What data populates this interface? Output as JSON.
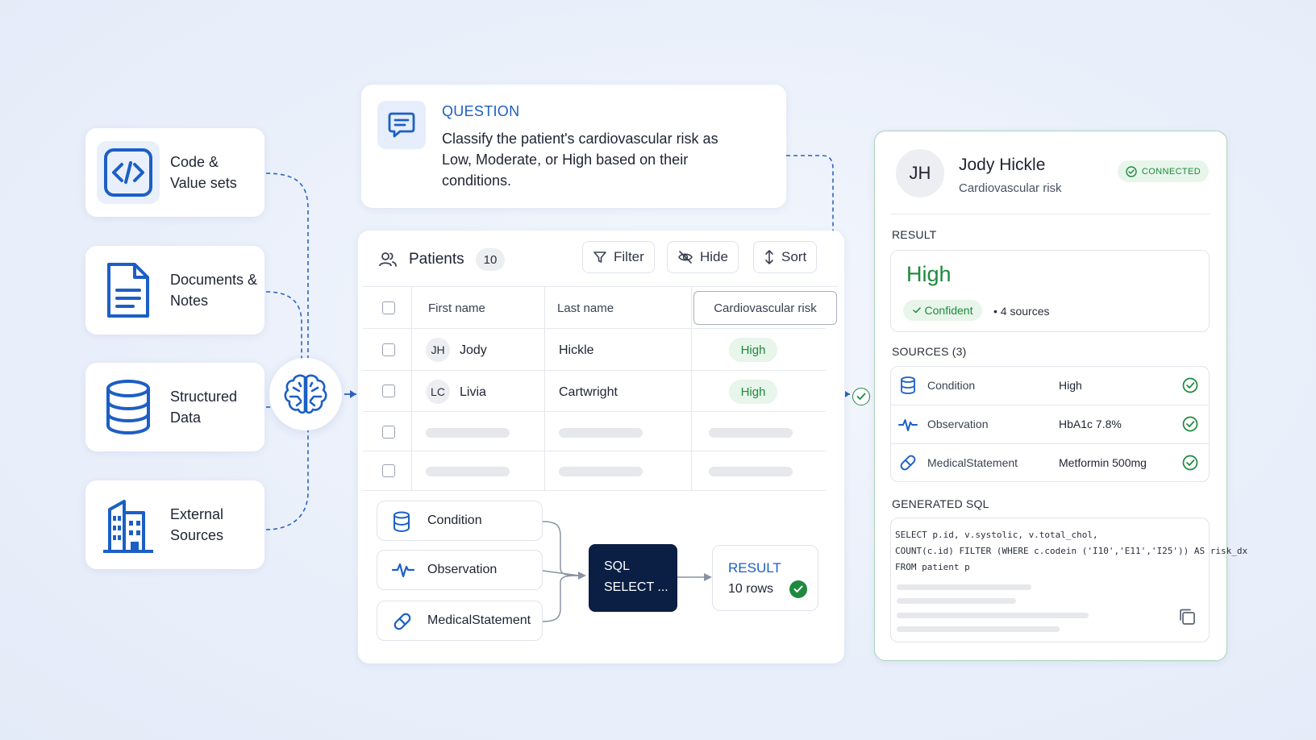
{
  "sources": [
    {
      "label": "Code &\nValue sets",
      "icon": "code-icon"
    },
    {
      "label": "Documents &\nNotes",
      "icon": "document-icon"
    },
    {
      "label": "Structured\nData",
      "icon": "database-icon"
    },
    {
      "label": "External\nSources",
      "icon": "building-icon"
    }
  ],
  "question": {
    "title": "QUESTION",
    "text": "Classify the patient's cardiovascular risk as Low, Moderate, or High based on their conditions."
  },
  "table": {
    "title": "Patients",
    "count": "10",
    "buttons": {
      "filter": "Filter",
      "hide": "Hide",
      "sort": "Sort"
    },
    "columns": [
      "First name",
      "Last name",
      "Cardiovascular risk"
    ],
    "rows": [
      {
        "initials": "JH",
        "first": "Jody",
        "last": "Hickle",
        "risk": "High"
      },
      {
        "initials": "LC",
        "first": "Livia",
        "last": "Cartwright",
        "risk": "High"
      }
    ]
  },
  "pipeline": {
    "inputs": [
      "Condition",
      "Observation",
      "MedicalStatement"
    ],
    "sql_line1": "SQL",
    "sql_line2": "SELECT ...",
    "result_label": "RESULT",
    "result_value": "10 rows"
  },
  "patient": {
    "initials": "JH",
    "name": "Jody Hickle",
    "subtitle": "Cardiovascular risk",
    "status": "CONNECTED",
    "result_header": "RESULT",
    "result_value": "High",
    "confidence": "Confident",
    "sources_count": "• 4 sources",
    "sources_header": "SOURCES (3)",
    "sources": [
      {
        "type": "Condition",
        "value": "High",
        "icon": "database-icon"
      },
      {
        "type": "Observation",
        "value": "HbA1c 7.8%",
        "icon": "pulse-icon"
      },
      {
        "type": "MedicalStatement",
        "value": "Metformin 500mg",
        "icon": "pill-icon"
      }
    ],
    "sql_header": "GENERATED SQL",
    "sql_lines": [
      "SELECT p.id, v.systolic, v.total_chol,",
      "COUNT(c.id) FILTER (WHERE c.codein ('I10','E11','I25')) AS risk_dx",
      "FROM patient p"
    ]
  },
  "colors": {
    "accent": "#1c5fc4",
    "success": "#1e8a3e",
    "navy": "#0b1f44",
    "panel_border": "#a9d4b8"
  }
}
